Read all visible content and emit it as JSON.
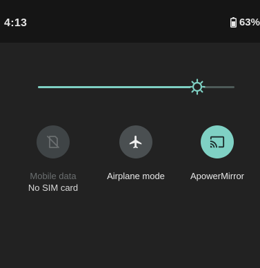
{
  "status_bar": {
    "time": "4:13",
    "battery_percent": "63%",
    "battery_icon": "battery-icon"
  },
  "brightness": {
    "level": 0.81,
    "thumb_icon": "brightness-icon",
    "accent": "#7fd1c4",
    "track": "#4d5a58"
  },
  "tiles": [
    {
      "label": "Mobile data",
      "sublabel": "No SIM card",
      "icon": "no-sim-icon",
      "state": "unavailable"
    },
    {
      "label": "Airplane mode",
      "icon": "airplane-icon",
      "state": "off"
    },
    {
      "label": "ApowerMirror",
      "icon": "cast-icon",
      "state": "on"
    }
  ],
  "colors": {
    "background": "#222222",
    "status_bar": "#151515",
    "active": "#7fd1c4",
    "inactive": "#3f4446"
  }
}
